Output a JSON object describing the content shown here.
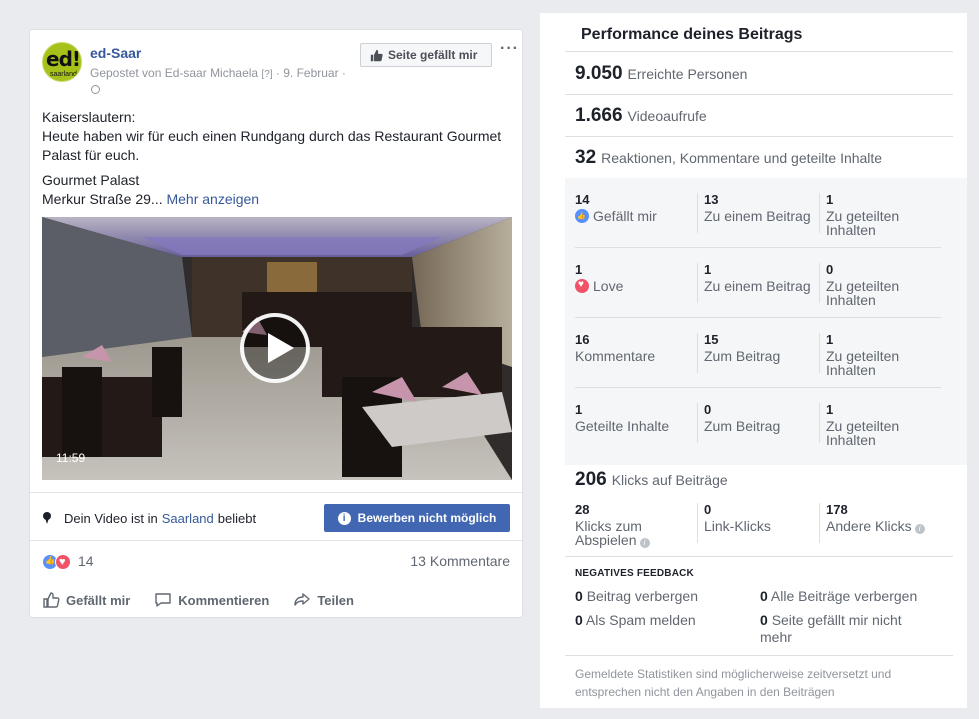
{
  "post": {
    "page_name": "ed-Saar",
    "avatar_text_1": "ed!",
    "avatar_text_2": "saarland",
    "meta_prefix": "Gepostet von Ed-saar Michaela",
    "meta_help": "[?]",
    "meta_date": "· 9. Februar ·",
    "like_page_label": "Seite gefällt mir",
    "more_label": "···",
    "text_line1": "Kaiserslautern:",
    "text_line2": "Heute haben wir für euch einen Rundgang durch das Restaurant Gourmet Palast für euch.",
    "text_line3": "Gourmet Palast",
    "text_line4": "Merkur Straße 29...",
    "more_link": "Mehr anzeigen",
    "video_duration": "11:59",
    "location_prefix": "Dein Video ist in",
    "location_place": "Saarland",
    "location_suffix": "beliebt",
    "boost_label": "Bewerben nicht möglich",
    "reaction_count": "14",
    "comment_count": "13 Kommentare",
    "actions": {
      "like": "Gefällt mir",
      "comment": "Kommentieren",
      "share": "Teilen"
    }
  },
  "insights": {
    "title": "Performance deines Beitrags",
    "reach_num": "9.050",
    "reach_label": "Erreichte Personen",
    "views_num": "1.666",
    "views_label": "Videoaufrufe",
    "engagement_num": "32",
    "engagement_label": "Reaktionen, Kommentare und geteilte Inhalte",
    "rows": [
      {
        "c1_num": "14",
        "c1_label": "Gefällt mir",
        "c2_num": "13",
        "c2_label": "Zu einem Beitrag",
        "c3_num": "1",
        "c3_label": "Zu geteilten Inhalten"
      },
      {
        "c1_num": "1",
        "c1_label": "Love",
        "c2_num": "1",
        "c2_label": "Zu einem Beitrag",
        "c3_num": "0",
        "c3_label": "Zu geteilten Inhalten"
      },
      {
        "c1_num": "16",
        "c1_label": "Kommentare",
        "c2_num": "15",
        "c2_label": "Zum Beitrag",
        "c3_num": "1",
        "c3_label": "Zu geteilten Inhalten"
      },
      {
        "c1_num": "1",
        "c1_label": "Geteilte Inhalte",
        "c2_num": "0",
        "c2_label": "Zum Beitrag",
        "c3_num": "1",
        "c3_label": "Zu geteilten Inhalten"
      }
    ],
    "clicks_num": "206",
    "clicks_label": "Klicks auf Beiträge",
    "clicks": [
      {
        "num": "28",
        "label": "Klicks zum Abspielen"
      },
      {
        "num": "0",
        "label": "Link-Klicks"
      },
      {
        "num": "178",
        "label": "Andere Klicks"
      }
    ],
    "neg_title": "NEGATIVES FEEDBACK",
    "neg": [
      {
        "num": "0",
        "label": "Beitrag verbergen"
      },
      {
        "num": "0",
        "label": "Alle Beiträge verbergen"
      },
      {
        "num": "0",
        "label": "Als Spam melden"
      },
      {
        "num": "0",
        "label": "Seite gefällt mir nicht mehr"
      }
    ],
    "footnote": "Gemeldete Statistiken sind möglicherweise zeitversetzt und entsprechen nicht den Angaben in den Beiträgen",
    "info_glyph": "i"
  },
  "colors": {
    "link": "#365899",
    "button": "#4267b2",
    "like": "#5890ff",
    "love": "#f25268"
  }
}
